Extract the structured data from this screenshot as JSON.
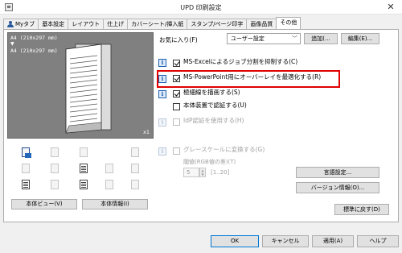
{
  "window": {
    "title": "UPD 印刷設定",
    "close": "✕"
  },
  "tabs": [
    {
      "label": "Myタブ"
    },
    {
      "label": "基本設定"
    },
    {
      "label": "レイアウト"
    },
    {
      "label": "仕上げ"
    },
    {
      "label": "カバーシート/挿入紙"
    },
    {
      "label": "スタンプ/ページ印字"
    },
    {
      "label": "画像品質"
    },
    {
      "label": "その他"
    }
  ],
  "preview": {
    "original_size": "A4 (210x297 mm)",
    "arrow": "▼",
    "output_size": "A4 (210x297 mm)",
    "copies": "x1"
  },
  "left_buttons": {
    "printer_view": "本体ビュー(V)",
    "printer_info": "本体情報(I)"
  },
  "favorites": {
    "label": "お気に入り(F)",
    "selected": "ユーザー設定",
    "add": "追加(...",
    "edit": "編集(E)..."
  },
  "options": [
    {
      "label": "MS-Excelによるジョブ分割を抑制する(C)",
      "checked": true,
      "enabled": true
    },
    {
      "label": "MS-PowerPoint用にオーバーレイを最適化する(R)",
      "checked": true,
      "enabled": true
    },
    {
      "label": "極細線を描画する(S)",
      "checked": true,
      "enabled": true
    },
    {
      "label": "本体装置で認証する(U)",
      "checked": false,
      "enabled": true
    },
    {
      "label": "IdP認証を使用する(H)",
      "checked": false,
      "enabled": false
    },
    {
      "label": "グレースケールに変換する(G)",
      "checked": false,
      "enabled": false
    }
  ],
  "threshold": {
    "label": "閾値(RGB値の差)(T)",
    "value": "5",
    "range": "[1..20]"
  },
  "right_buttons": {
    "language": "言語設定...",
    "version": "バージョン情報(O)...",
    "restore": "標準に戻す(D)"
  },
  "bottom": {
    "ok": "OK",
    "cancel": "キャンセル",
    "apply": "適用(A)",
    "help": "ヘルプ"
  }
}
